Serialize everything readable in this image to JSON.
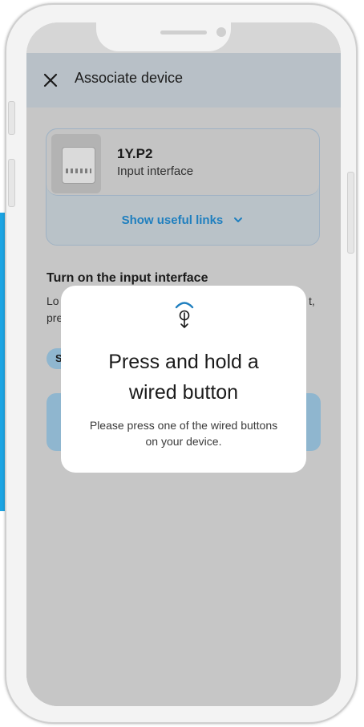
{
  "header": {
    "title": "Associate device"
  },
  "device": {
    "name": "1Y.P2",
    "type": "Input interface",
    "links_label": "Show useful links"
  },
  "section": {
    "title": "Turn on the input interface",
    "line1_start": "Lo",
    "line1_end": "t,",
    "line2_start": "pre",
    "chip_label": "S"
  },
  "dialog": {
    "title_line1": "Press and hold a",
    "title_line2": "wired button",
    "text_line1": "Please press one of the wired buttons",
    "text_line2": "on your device."
  },
  "colors": {
    "accent": "#1f7fbf",
    "side_bar": "#1ba4e3",
    "overlay": "#c6c6c6"
  }
}
